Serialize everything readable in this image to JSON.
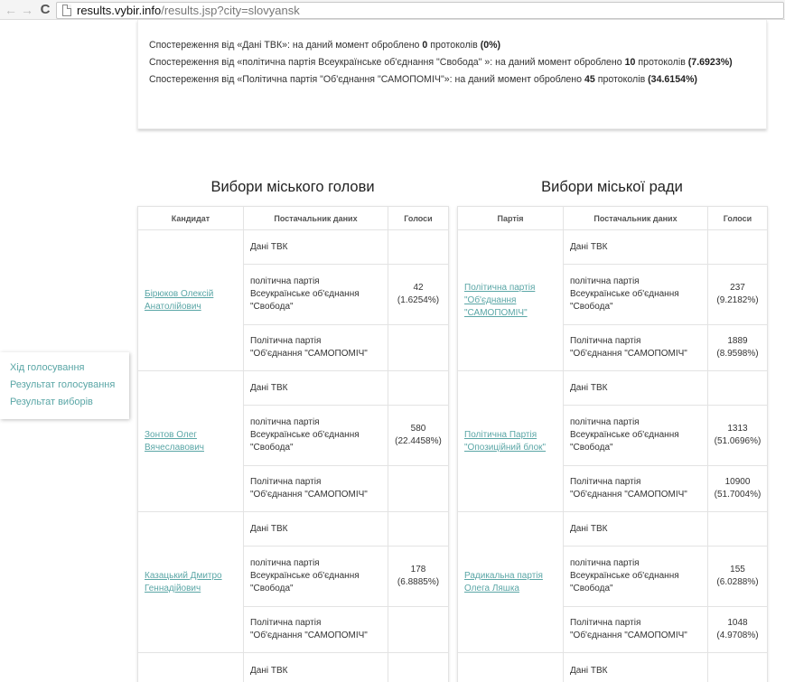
{
  "browser": {
    "url_host": "results.vybir.info",
    "url_path": "/results.jsp?city=slovyansk"
  },
  "observations": [
    {
      "prefix": "Спостереження від «Дані ТВК»: на даний момент оброблено ",
      "count": "0",
      "mid": " протоколів ",
      "pct": "(0%)"
    },
    {
      "prefix": "Спостереження від «політична партія Всеукраїнське об'єднання \"Свобода\" »: на даний момент оброблено ",
      "count": "10",
      "mid": " протоколів ",
      "pct": "(7.6923%)"
    },
    {
      "prefix": "Спостереження від «Політична партія \"Об'єднання \"САМОПОМІЧ\"»: на даний момент оброблено ",
      "count": "45",
      "mid": " протоколів ",
      "pct": "(34.6154%)"
    }
  ],
  "side_menu": {
    "items": [
      "Хід голосування",
      "Результат голосування",
      "Результат виборів"
    ]
  },
  "mayor": {
    "title": "Вибори міського голови",
    "headers": [
      "Кандидат",
      "Постачальник даних",
      "Голоси"
    ],
    "rows": [
      {
        "name": "Бірюков Олексій Анатолійович",
        "votes": "42",
        "pct": "(1.6254%)",
        "samo_votes": "",
        "samo_pct": ""
      },
      {
        "name": "Зонтов Олег Вячеславович",
        "votes": "580",
        "pct": "(22.4458%)",
        "samo_votes": "",
        "samo_pct": ""
      },
      {
        "name": "Казацький Дмитро Геннадійович",
        "votes": "178",
        "pct": "(6.8885%)",
        "samo_votes": "",
        "samo_pct": ""
      }
    ]
  },
  "council": {
    "title": "Вибори міської ради",
    "headers": [
      "Партія",
      "Постачальник даних",
      "Голоси"
    ],
    "rows": [
      {
        "name": "Політична партія \"Об'єднання \"САМОПОМІЧ\"",
        "votes": "237",
        "pct": "(9.2182%)",
        "samo_votes": "1889",
        "samo_pct": "(8.9598%)"
      },
      {
        "name": "Політична Партія \"Опозиційний блок\"",
        "votes": "1313",
        "pct": "(51.0696%)",
        "samo_votes": "10900",
        "samo_pct": "(51.7004%)"
      },
      {
        "name": "Радикальна партія Олега Ляшка",
        "votes": "155",
        "pct": "(6.0288%)",
        "samo_votes": "1048",
        "samo_pct": "(4.9708%)"
      }
    ]
  },
  "providers": {
    "tvk": "Дані ТВК",
    "svoboda_line1": "політична партія",
    "svoboda_line2": "Всеукраїнське об'єднання",
    "svoboda_line3": "\"Свобода\"",
    "samo_line1": "Політична партія",
    "samo_line2": "\"Об'єднання \"САМОПОМІЧ\""
  }
}
